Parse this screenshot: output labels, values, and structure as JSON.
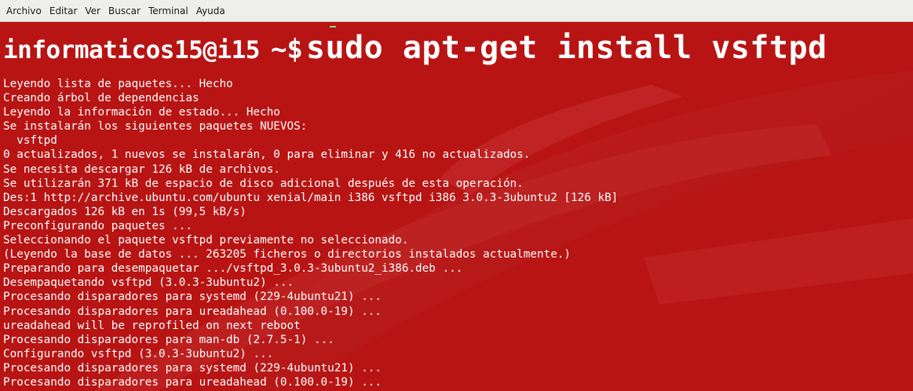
{
  "menubar": {
    "items": [
      "Archivo",
      "Editar",
      "Ver",
      "Buscar",
      "Terminal",
      "Ayuda"
    ]
  },
  "terminal": {
    "prompt_user": "informaticos15@i15",
    "prompt_symbol": "~$",
    "command": "sudo apt-get install vsftpd",
    "output_lines": [
      "Leyendo lista de paquetes... Hecho",
      "Creando árbol de dependencias",
      "Leyendo la información de estado... Hecho",
      "Se instalarán los siguientes paquetes NUEVOS:",
      "  vsftpd",
      "0 actualizados, 1 nuevos se instalarán, 0 para eliminar y 416 no actualizados.",
      "Se necesita descargar 126 kB de archivos.",
      "Se utilizarán 371 kB de espacio de disco adicional después de esta operación.",
      "Des:1 http://archive.ubuntu.com/ubuntu xenial/main i386 vsftpd i386 3.0.3-3ubuntu2 [126 kB]",
      "Descargados 126 kB en 1s (99,5 kB/s)",
      "Preconfigurando paquetes ...",
      "Seleccionando el paquete vsftpd previamente no seleccionado.",
      "(Leyendo la base de datos ... 263205 ficheros o directorios instalados actualmente.)",
      "Preparando para desempaquetar .../vsftpd_3.0.3-3ubuntu2_i386.deb ...",
      "Desempaquetando vsftpd (3.0.3-3ubuntu2) ...",
      "Procesando disparadores para systemd (229-4ubuntu21) ...",
      "Procesando disparadores para ureadahead (0.100.0-19) ...",
      "ureadahead will be reprofiled on next reboot",
      "Procesando disparadores para man-db (2.7.5-1) ...",
      "Configurando vsftpd (3.0.3-3ubuntu2) ...",
      "Procesando disparadores para systemd (229-4ubuntu21) ...",
      "Procesando disparadores para ureadahead (0.100.0-19) ..."
    ],
    "colors": {
      "background": "#b81414",
      "text": "#ffffff",
      "menubar": "#eeeeec"
    }
  }
}
